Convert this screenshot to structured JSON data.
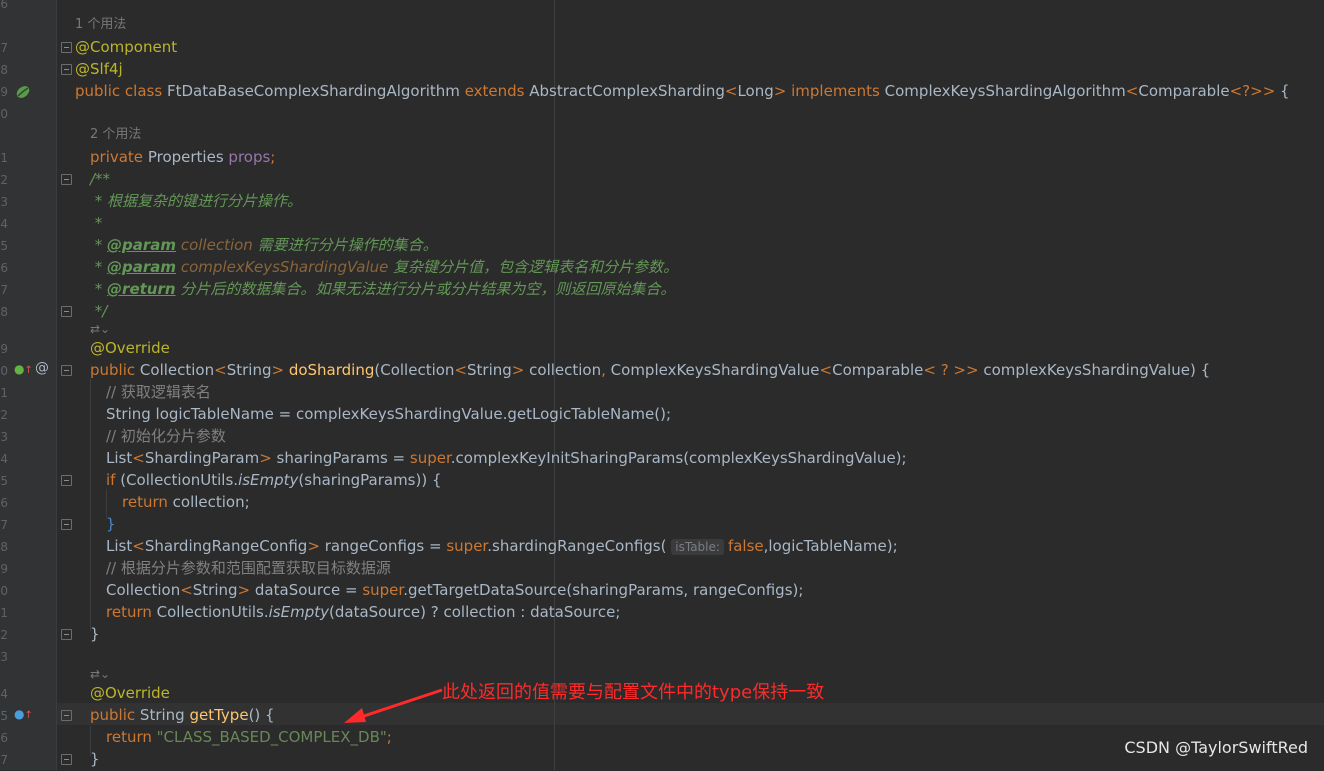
{
  "editor": {
    "gutter_line_numbers": [
      "6",
      "7",
      "8",
      "9",
      "0",
      "",
      "1",
      "2",
      "3",
      "4",
      "5",
      "6",
      "7",
      "8",
      "",
      "9",
      "0",
      "1",
      "2",
      "3",
      "4",
      "5",
      "6",
      "7",
      "8",
      "9",
      "0",
      "1",
      "2",
      "3",
      "",
      "4",
      "5",
      "6",
      "7"
    ],
    "usage_hints": [
      "1 个用法",
      "2 个用法"
    ],
    "inlay_hint": "isTable:",
    "folded_doc_marker": "⇄⌄"
  },
  "code": {
    "ann_component": "@Component",
    "ann_slf4j": "@Slf4j",
    "kw_public": "public",
    "kw_class": "class",
    "class_name": "FtDataBaseComplexShardingAlgorithm",
    "kw_extends": "extends",
    "super_class": "AbstractComplexSharding",
    "type_arg_long": "Long",
    "kw_implements": "implements",
    "iface": "ComplexKeysShardingAlgorithm",
    "type_comparable": "Comparable",
    "kw_private": "private",
    "type_properties": "Properties",
    "field_props": "props",
    "doc_open": "/**",
    "doc_line1": " * 根据复杂的键进行分片操作。",
    "doc_star": " *",
    "doc_tag_param": "@param",
    "doc_param1_name": "collection",
    "doc_param1_desc": " 需要进行分片操作的集合。",
    "doc_param2_name": "complexKeysShardingValue",
    "doc_param2_desc": " 复杂键分片值，包含逻辑表名和分片参数。",
    "doc_tag_return": "@return",
    "doc_return_desc": " 分片后的数据集合。如果无法进行分片或分片结果为空，则返回原始集合。",
    "doc_close": " */",
    "ann_override": "@Override",
    "type_collection": "Collection",
    "type_string": "String",
    "method_do_sharding": "doSharding",
    "param_collection": "collection",
    "type_ckv": "ComplexKeysShardingValue",
    "param_ckv": "complexKeysShardingValue",
    "comment_get_logic": "// 获取逻辑表名",
    "var_logic_table": "logicTableName",
    "call_get_logic": "complexKeysShardingValue.getLogicTableName();",
    "comment_init_params": "// 初始化分片参数",
    "type_list": "List",
    "type_sharding_param": "ShardingParam",
    "var_sharing_params": "sharingParams",
    "kw_super": "super",
    "call_init_params": ".complexKeyInitSharingParams(complexKeysShardingValue);",
    "kw_if": "if",
    "util_class": "CollectionUtils.",
    "method_is_empty": "isEmpty",
    "if_arg": "(sharingParams)) {",
    "kw_return": "return",
    "return_collection": " collection;",
    "type_range_config": "ShardingRangeConfig",
    "var_range_configs": "rangeConfigs",
    "call_range_configs": ".shardingRangeConfigs(",
    "kw_false": "false",
    "range_tail": ",logicTableName);",
    "comment_get_target": "// 根据分片参数和范围配置获取目标数据源",
    "var_data_source": "dataSource",
    "call_get_target": ".getTargetDataSource(sharingParams, rangeConfigs);",
    "return_tail": "(dataSource) ? collection : dataSource;",
    "method_get_type": "getType",
    "str_type_value": "\"CLASS_BASED_COMPLEX_DB\""
  },
  "annotation": {
    "label": "此处返回的值需要与配置文件中的type保持一致",
    "color": "#ff2a2a"
  },
  "watermark": "CSDN @TaylorSwiftRed",
  "colors": {
    "background": "#2b2b2b",
    "gutter": "#313335",
    "keyword": "#cc7832",
    "annotation": "#bbb529",
    "method": "#ffc66d",
    "field": "#9876aa",
    "string": "#6a8759",
    "comment": "#808080"
  },
  "icons": {
    "class_gutter": "bean-icon",
    "override_gutter": "override-up-icon",
    "at_gutter": "at-sign-icon",
    "fold": "fold-icon"
  }
}
